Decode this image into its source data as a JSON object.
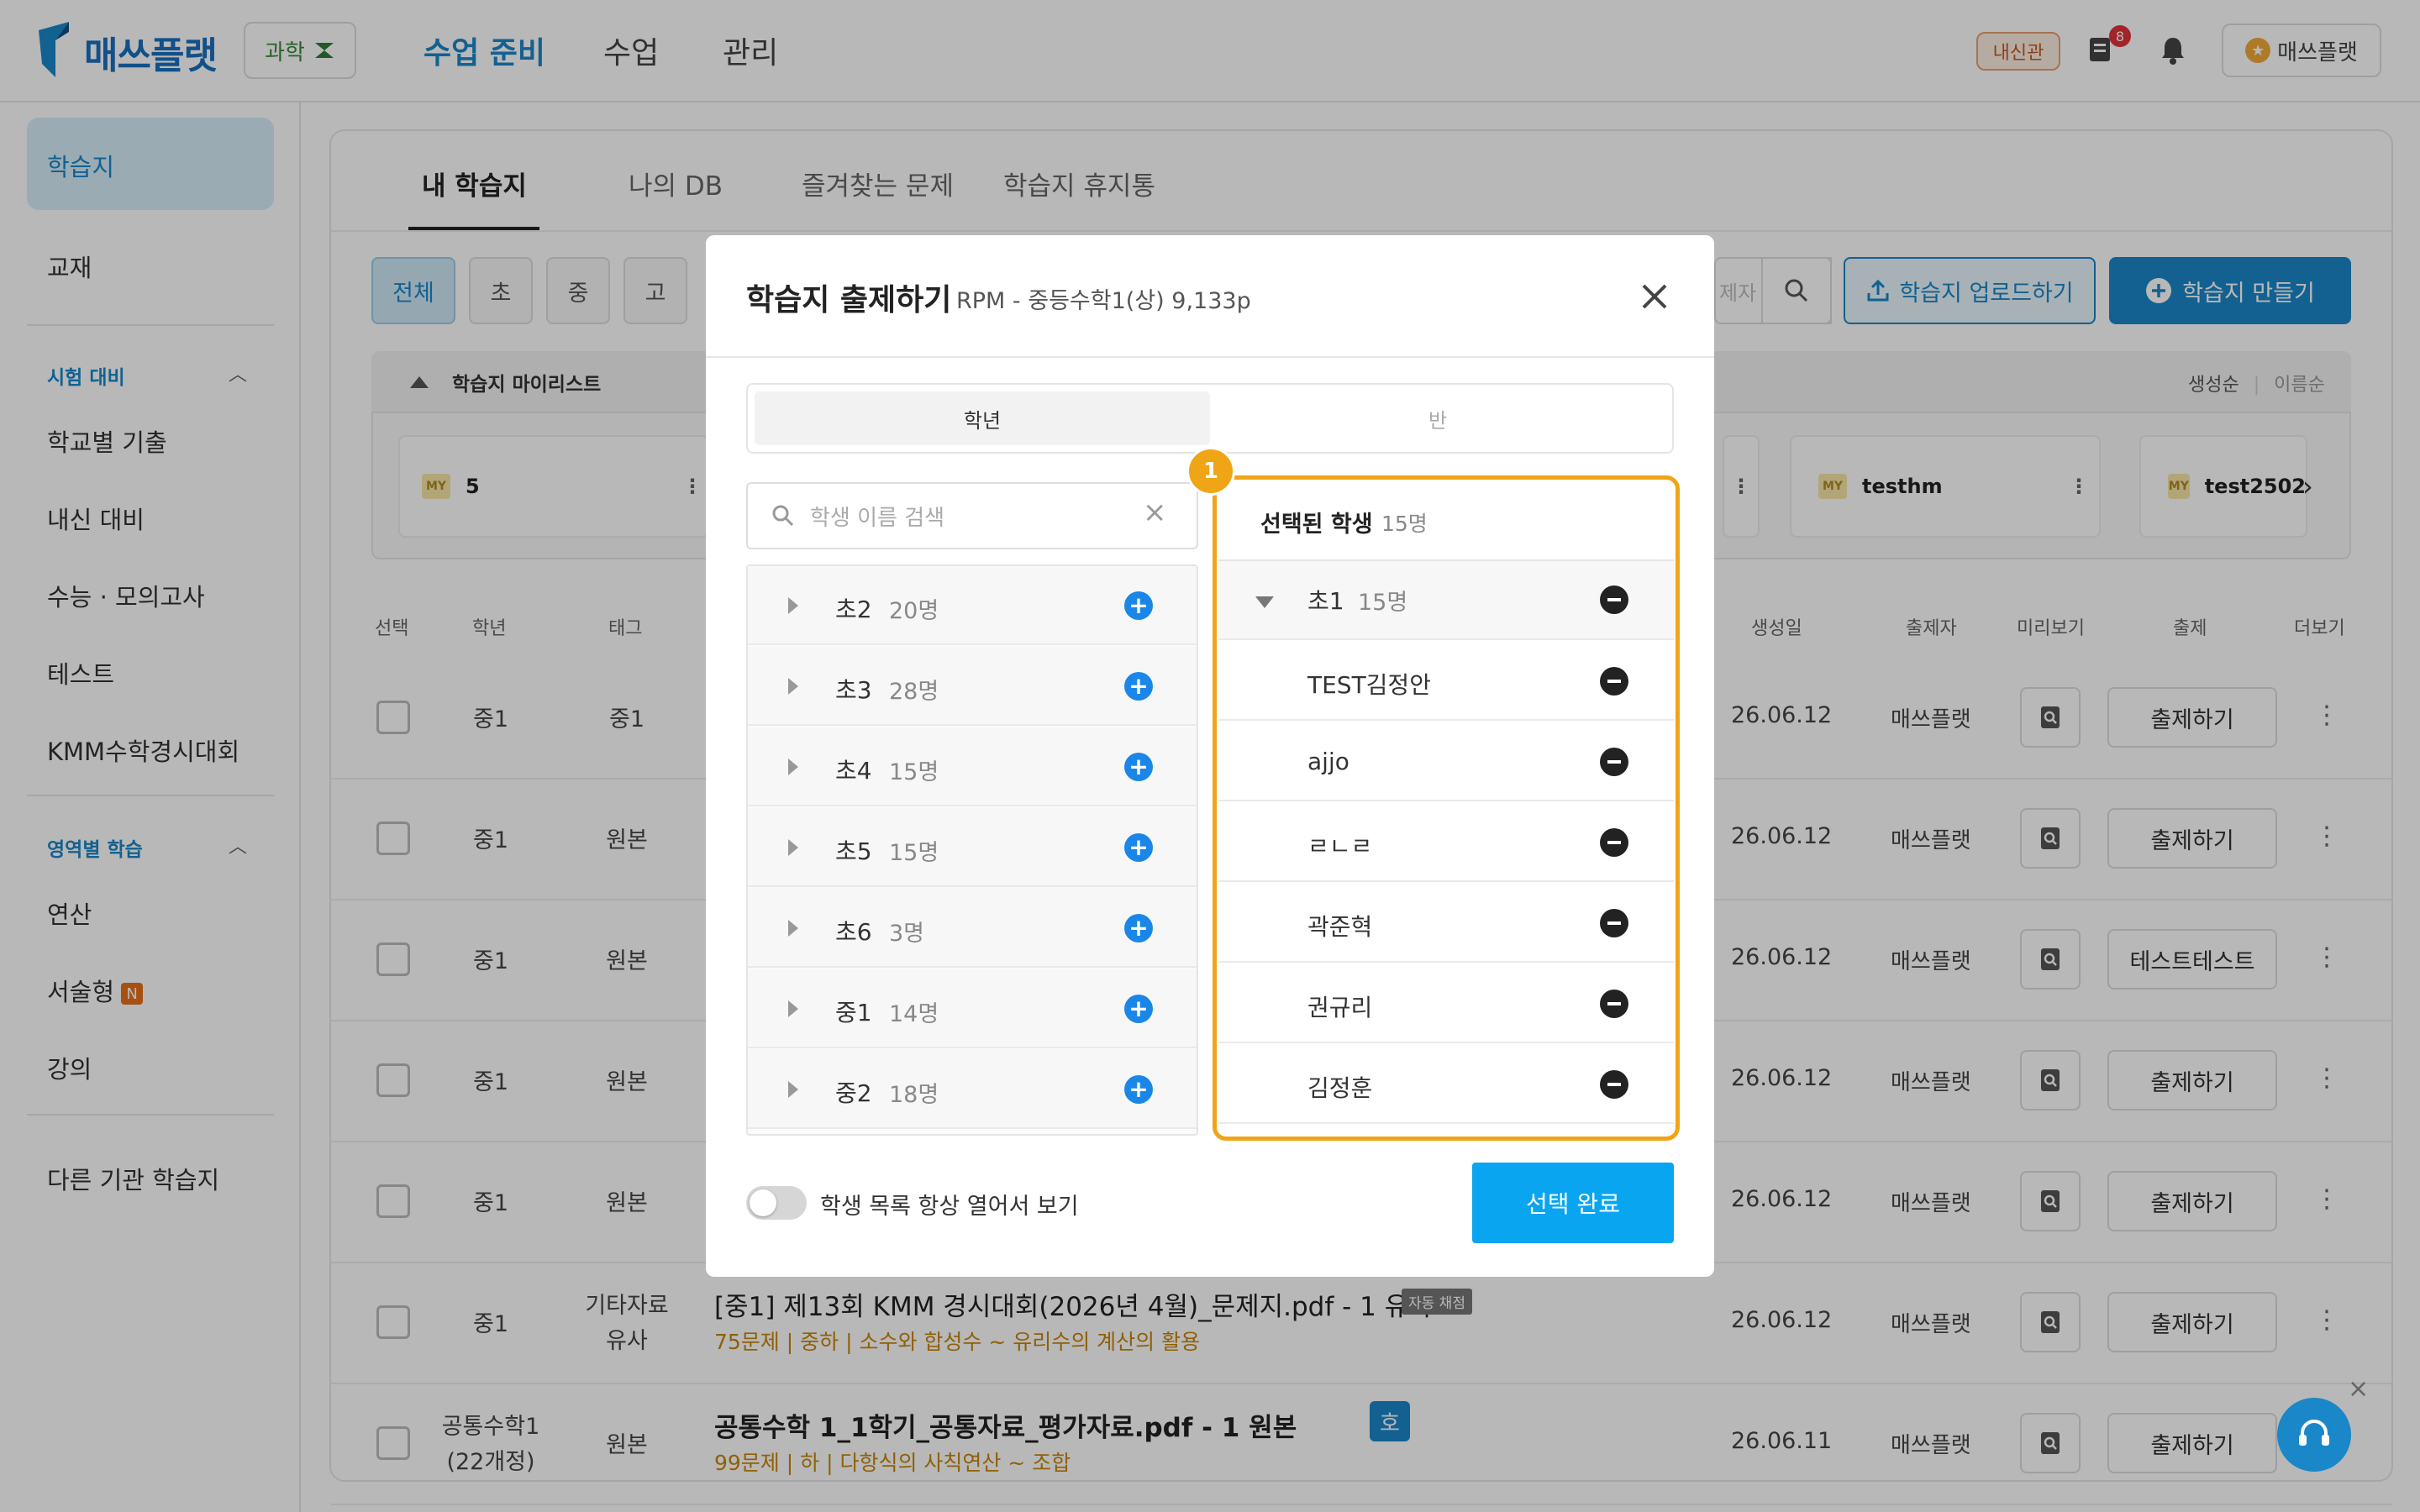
{
  "topbar": {
    "logo": "매쓰플랫",
    "subject": "과학",
    "nav": [
      "수업 준비",
      "수업",
      "관리"
    ],
    "campus": "내신관",
    "doc_badge": "8",
    "user": "매쓰플랫"
  },
  "sidebar": {
    "items": [
      "학습지",
      "교재"
    ],
    "section1": "시험 대비",
    "section1_items": [
      "학교별 기출",
      "내신 대비",
      "수능 · 모의고사",
      "테스트",
      "KMM수학경시대회"
    ],
    "section2": "영역별 학습",
    "section2_items": [
      "연산",
      "서술형",
      "강의"
    ],
    "new_badge": "N",
    "other": "다른 기관 학습지"
  },
  "main": {
    "tabs": [
      "내 학습지",
      "나의 DB",
      "즐겨찾는 문제",
      "학습지 휴지통"
    ],
    "filters": [
      "전체",
      "초",
      "중",
      "고"
    ],
    "search_tail": "제자",
    "upload_label": "학습지 업로드하기",
    "create_label": "학습지 만들기",
    "mylist_title": "학습지 마이리스트",
    "sort_new": "생성순",
    "sort_name": "이름순",
    "my_badge": "MY",
    "mylist_cards": [
      "5",
      "testhm",
      "test2502"
    ],
    "columns": [
      "선택",
      "학년",
      "태그",
      "생성일",
      "출제자",
      "미리보기",
      "출제",
      "더보기"
    ],
    "rows": [
      {
        "grade": "중1",
        "tag": "중1",
        "date": "26.06.12",
        "author": "매쓰플랫",
        "action": "출제하기"
      },
      {
        "grade": "중1",
        "tag": "원본",
        "date": "26.06.12",
        "author": "매쓰플랫",
        "action": "출제하기"
      },
      {
        "grade": "중1",
        "tag": "원본",
        "date": "26.06.12",
        "author": "매쓰플랫",
        "action": "테스트테스트"
      },
      {
        "grade": "중1",
        "tag": "원본",
        "date": "26.06.12",
        "author": "매쓰플랫",
        "action": "출제하기"
      },
      {
        "grade": "중1",
        "tag": "원본",
        "date": "26.06.12",
        "author": "매쓰플랫",
        "action": "출제하기"
      },
      {
        "grade": "중1",
        "tag": "기타자료\n유사",
        "date": "26.06.12",
        "author": "매쓰플랫",
        "action": "출제하기",
        "title": "[중1] 제13회 KMM 경시대회(2026년 4월)_문제지.pdf - 1 유사",
        "auto_badge": "자동 채점",
        "meta": "75문제 | 중하 | 소수와 합성수 ~ 유리수의 계산의 활용"
      },
      {
        "grade": "공통수학1\n(22개정)",
        "tag": "원본",
        "date": "26.06.11",
        "author": "매쓰플랫",
        "action": "출제하기",
        "title": "공통수학 1_1학기_공통자료_평가자료.pdf - 1 원본",
        "type_badge": "호",
        "meta": "99문제 | 하 | 다항식의 사칙연산 ~ 조합"
      }
    ]
  },
  "modal": {
    "title": "학습지 출제하기",
    "subtitle": "RPM - 중등수학1(상) 9,133p",
    "tabs": [
      "학년",
      "반"
    ],
    "search_placeholder": "학생 이름 검색",
    "grades": [
      {
        "name": "초2",
        "count": "20명"
      },
      {
        "name": "초3",
        "count": "28명"
      },
      {
        "name": "초4",
        "count": "15명"
      },
      {
        "name": "초5",
        "count": "15명"
      },
      {
        "name": "초6",
        "count": "3명"
      },
      {
        "name": "중1",
        "count": "14명"
      },
      {
        "name": "중2",
        "count": "18명"
      }
    ],
    "step_marker": "1",
    "selected_title": "선택된 학생",
    "selected_count": "15명",
    "selected_group": {
      "name": "초1",
      "count": "15명"
    },
    "selected_students": [
      "TEST김정안",
      "ajjo",
      "ㄹㄴㄹ",
      "곽준혁",
      "권규리",
      "김정훈"
    ],
    "toggle_label": "학생 목록 항상 열어서 보기",
    "toggle_on": false,
    "done_label": "선택 완료"
  },
  "colors": {
    "accent": "#1a87c9",
    "highlight": "#f0a516",
    "done": "#0aa5f0",
    "tag_text": "#c8860a"
  }
}
